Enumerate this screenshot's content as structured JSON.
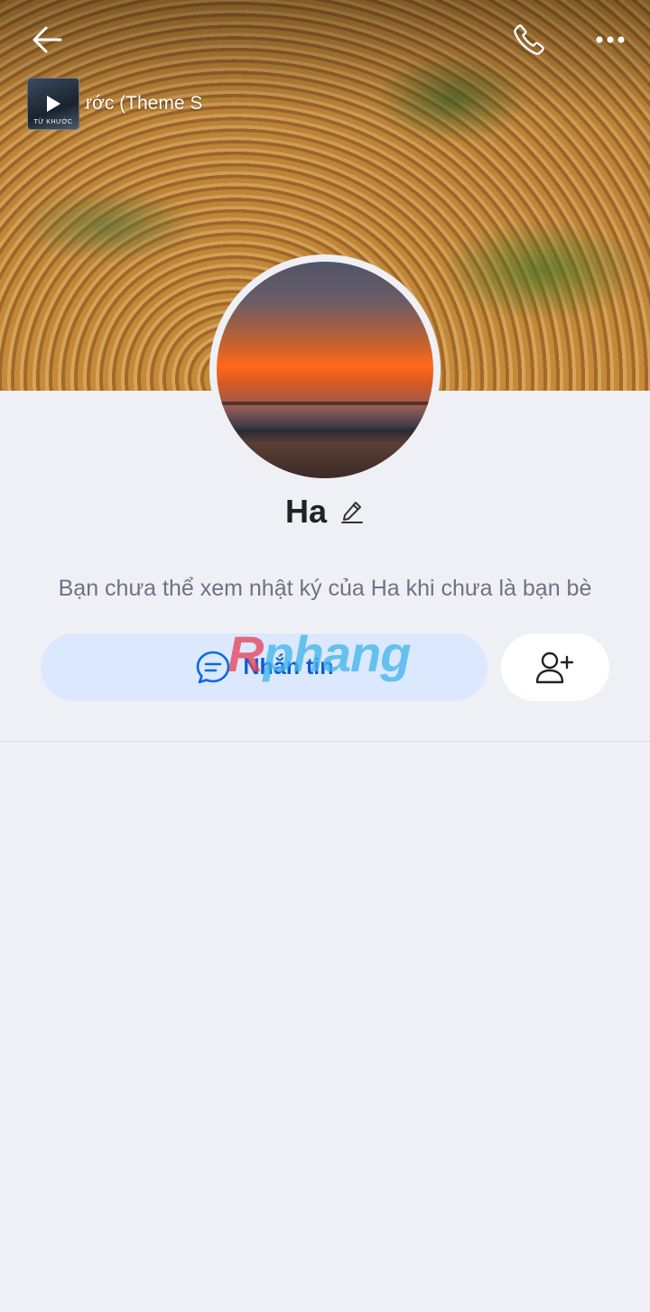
{
  "header": {
    "back_icon": "arrow-left-icon",
    "call_icon": "phone-icon",
    "more_icon": "more-dots-icon"
  },
  "music": {
    "title": "ước (Theme S",
    "album_caption": "TỪ KHƯỚC",
    "play_icon": "play-icon"
  },
  "profile": {
    "name": "Ha",
    "edit_icon": "pencil-icon",
    "diary_notice": "Bạn chưa thể xem nhật ký của Ha khi chưa là bạn bè"
  },
  "actions": {
    "message_label": "Nhắn tin",
    "message_icon": "chat-bubble-icon",
    "add_friend_icon": "add-friend-icon"
  },
  "watermark": {
    "part1": "R",
    "part2": "phang"
  },
  "colors": {
    "background": "#eff0f5",
    "primary": "#0a5bd3",
    "message_button_bg": "#dbe8fd"
  }
}
